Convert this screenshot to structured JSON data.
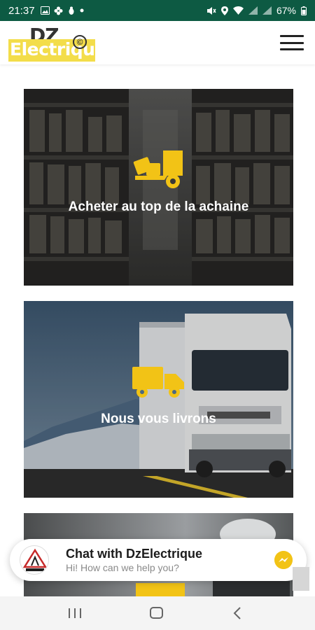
{
  "status_bar": {
    "time": "21:37",
    "battery": "67%",
    "left_icons": [
      "image-icon",
      "flower-icon",
      "bug-icon",
      "dot-icon"
    ],
    "right_icons": [
      "mute-icon",
      "location-icon",
      "wifi-icon",
      "signal-icon",
      "signal2-icon",
      "battery-icon"
    ]
  },
  "header": {
    "logo_top": "DZ",
    "logo_bottom": "Electrique",
    "logo_symbol": "©"
  },
  "cards": [
    {
      "title": "Acheter au top de la achaine",
      "icon": "dolly-boxes-icon"
    },
    {
      "title": "Nous vous livrons",
      "icon": "truck-icon"
    },
    {
      "title": "",
      "icon": "card3-icon"
    }
  ],
  "chat": {
    "title": "Chat with DzElectrique",
    "subtitle": "Hi! How can we help you?"
  },
  "colors": {
    "status_bar": "#0d5a43",
    "accent_yellow": "#f3dd4a",
    "icon_yellow": "#f2c316"
  }
}
